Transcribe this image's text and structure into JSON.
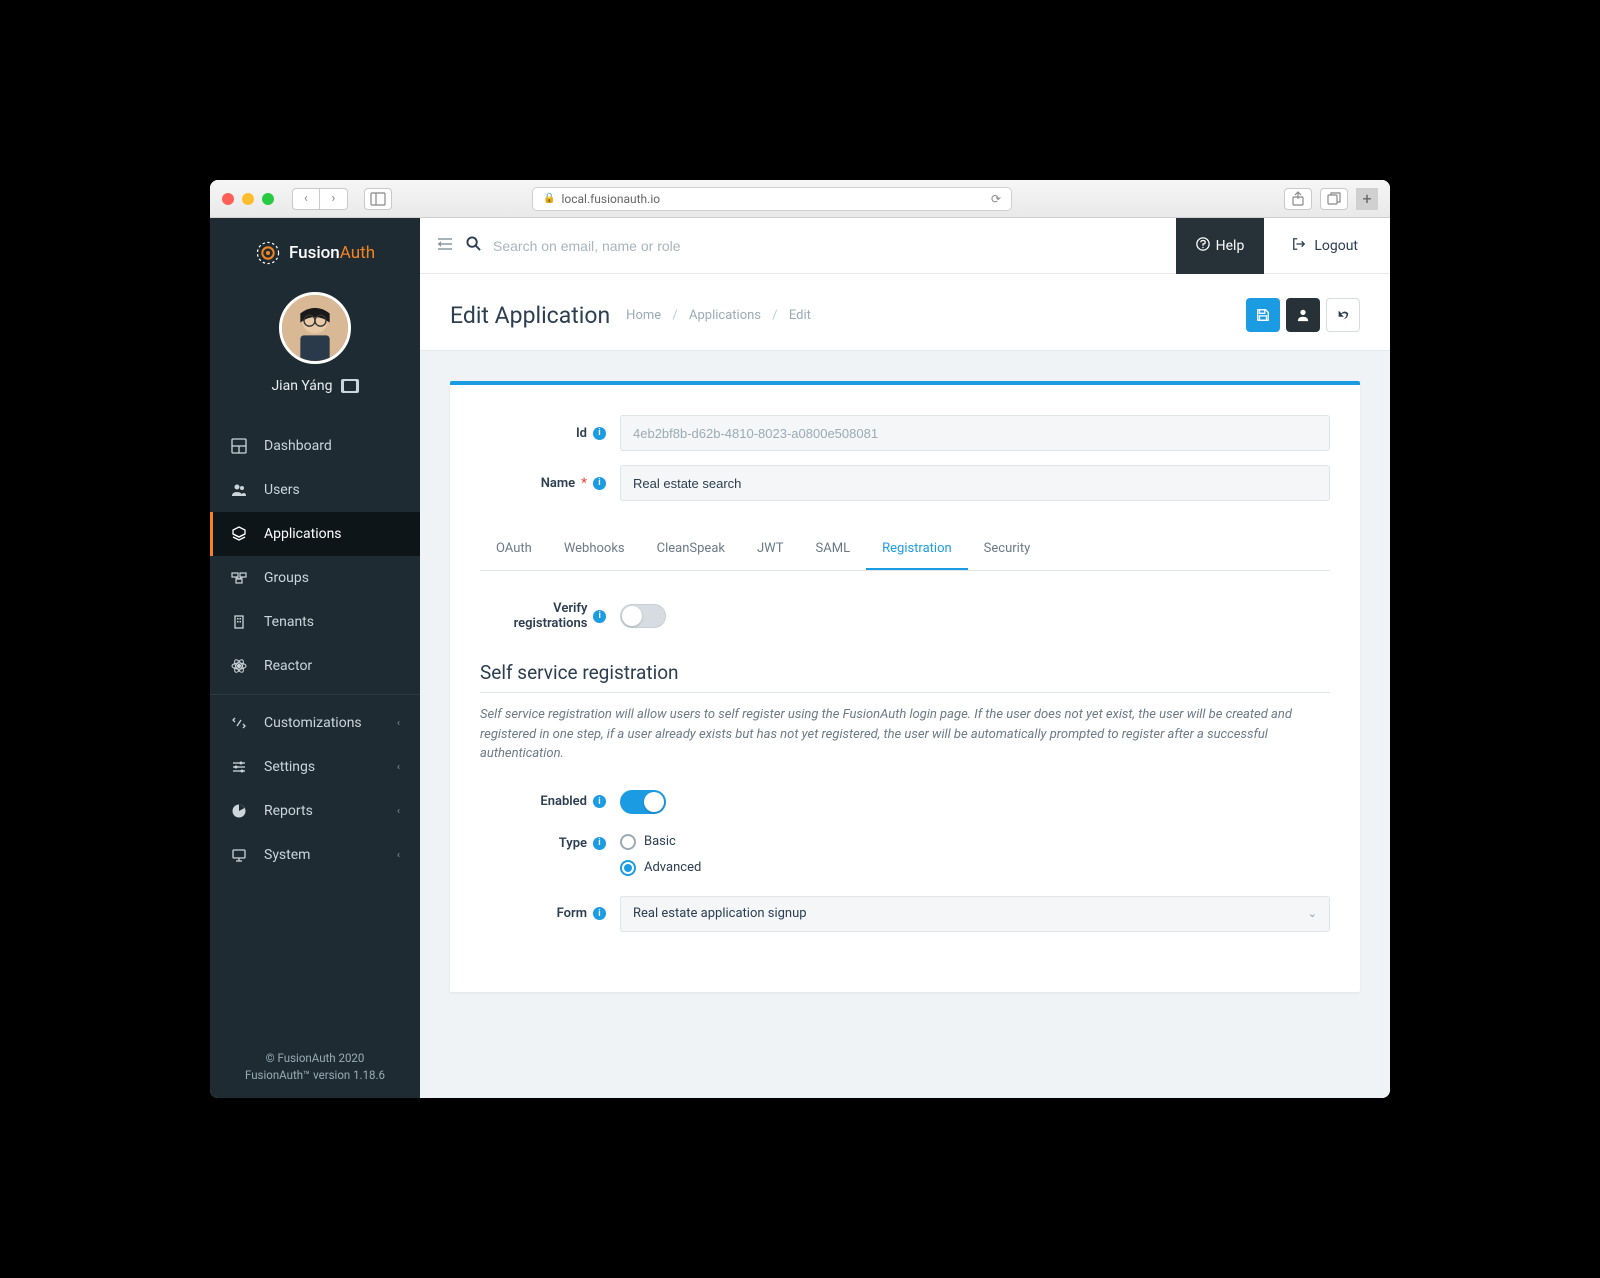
{
  "browser": {
    "url": "local.fusionauth.io"
  },
  "brand": {
    "name_prefix": "Fusion",
    "name_suffix": "Auth"
  },
  "user": {
    "name": "Jian Yáng"
  },
  "sidebar": {
    "items": [
      {
        "label": "Dashboard"
      },
      {
        "label": "Users"
      },
      {
        "label": "Applications"
      },
      {
        "label": "Groups"
      },
      {
        "label": "Tenants"
      },
      {
        "label": "Reactor"
      },
      {
        "label": "Customizations"
      },
      {
        "label": "Settings"
      },
      {
        "label": "Reports"
      },
      {
        "label": "System"
      }
    ]
  },
  "footer": {
    "copyright": "© FusionAuth 2020",
    "version": "FusionAuth™ version 1.18.6"
  },
  "topbar": {
    "search_placeholder": "Search on email, name or role",
    "help": "Help",
    "logout": "Logout"
  },
  "page": {
    "title": "Edit Application",
    "breadcrumb": [
      "Home",
      "Applications",
      "Edit"
    ]
  },
  "form": {
    "id_label": "Id",
    "id_value": "4eb2bf8b-d62b-4810-8023-a0800e508081",
    "name_label": "Name",
    "name_value": "Real estate search"
  },
  "tabs": [
    "OAuth",
    "Webhooks",
    "CleanSpeak",
    "JWT",
    "SAML",
    "Registration",
    "Security"
  ],
  "registration": {
    "verify_label": "Verify registrations",
    "self_service_title": "Self service registration",
    "self_service_desc": "Self service registration will allow users to self register using the FusionAuth login page. If the user does not yet exist, the user will be created and registered in one step, if a user already exists but has not yet registered, the user will be automatically prompted to register after a successful authentication.",
    "enabled_label": "Enabled",
    "type_label": "Type",
    "type_options": [
      "Basic",
      "Advanced"
    ],
    "form_label": "Form",
    "form_value": "Real estate application signup"
  }
}
